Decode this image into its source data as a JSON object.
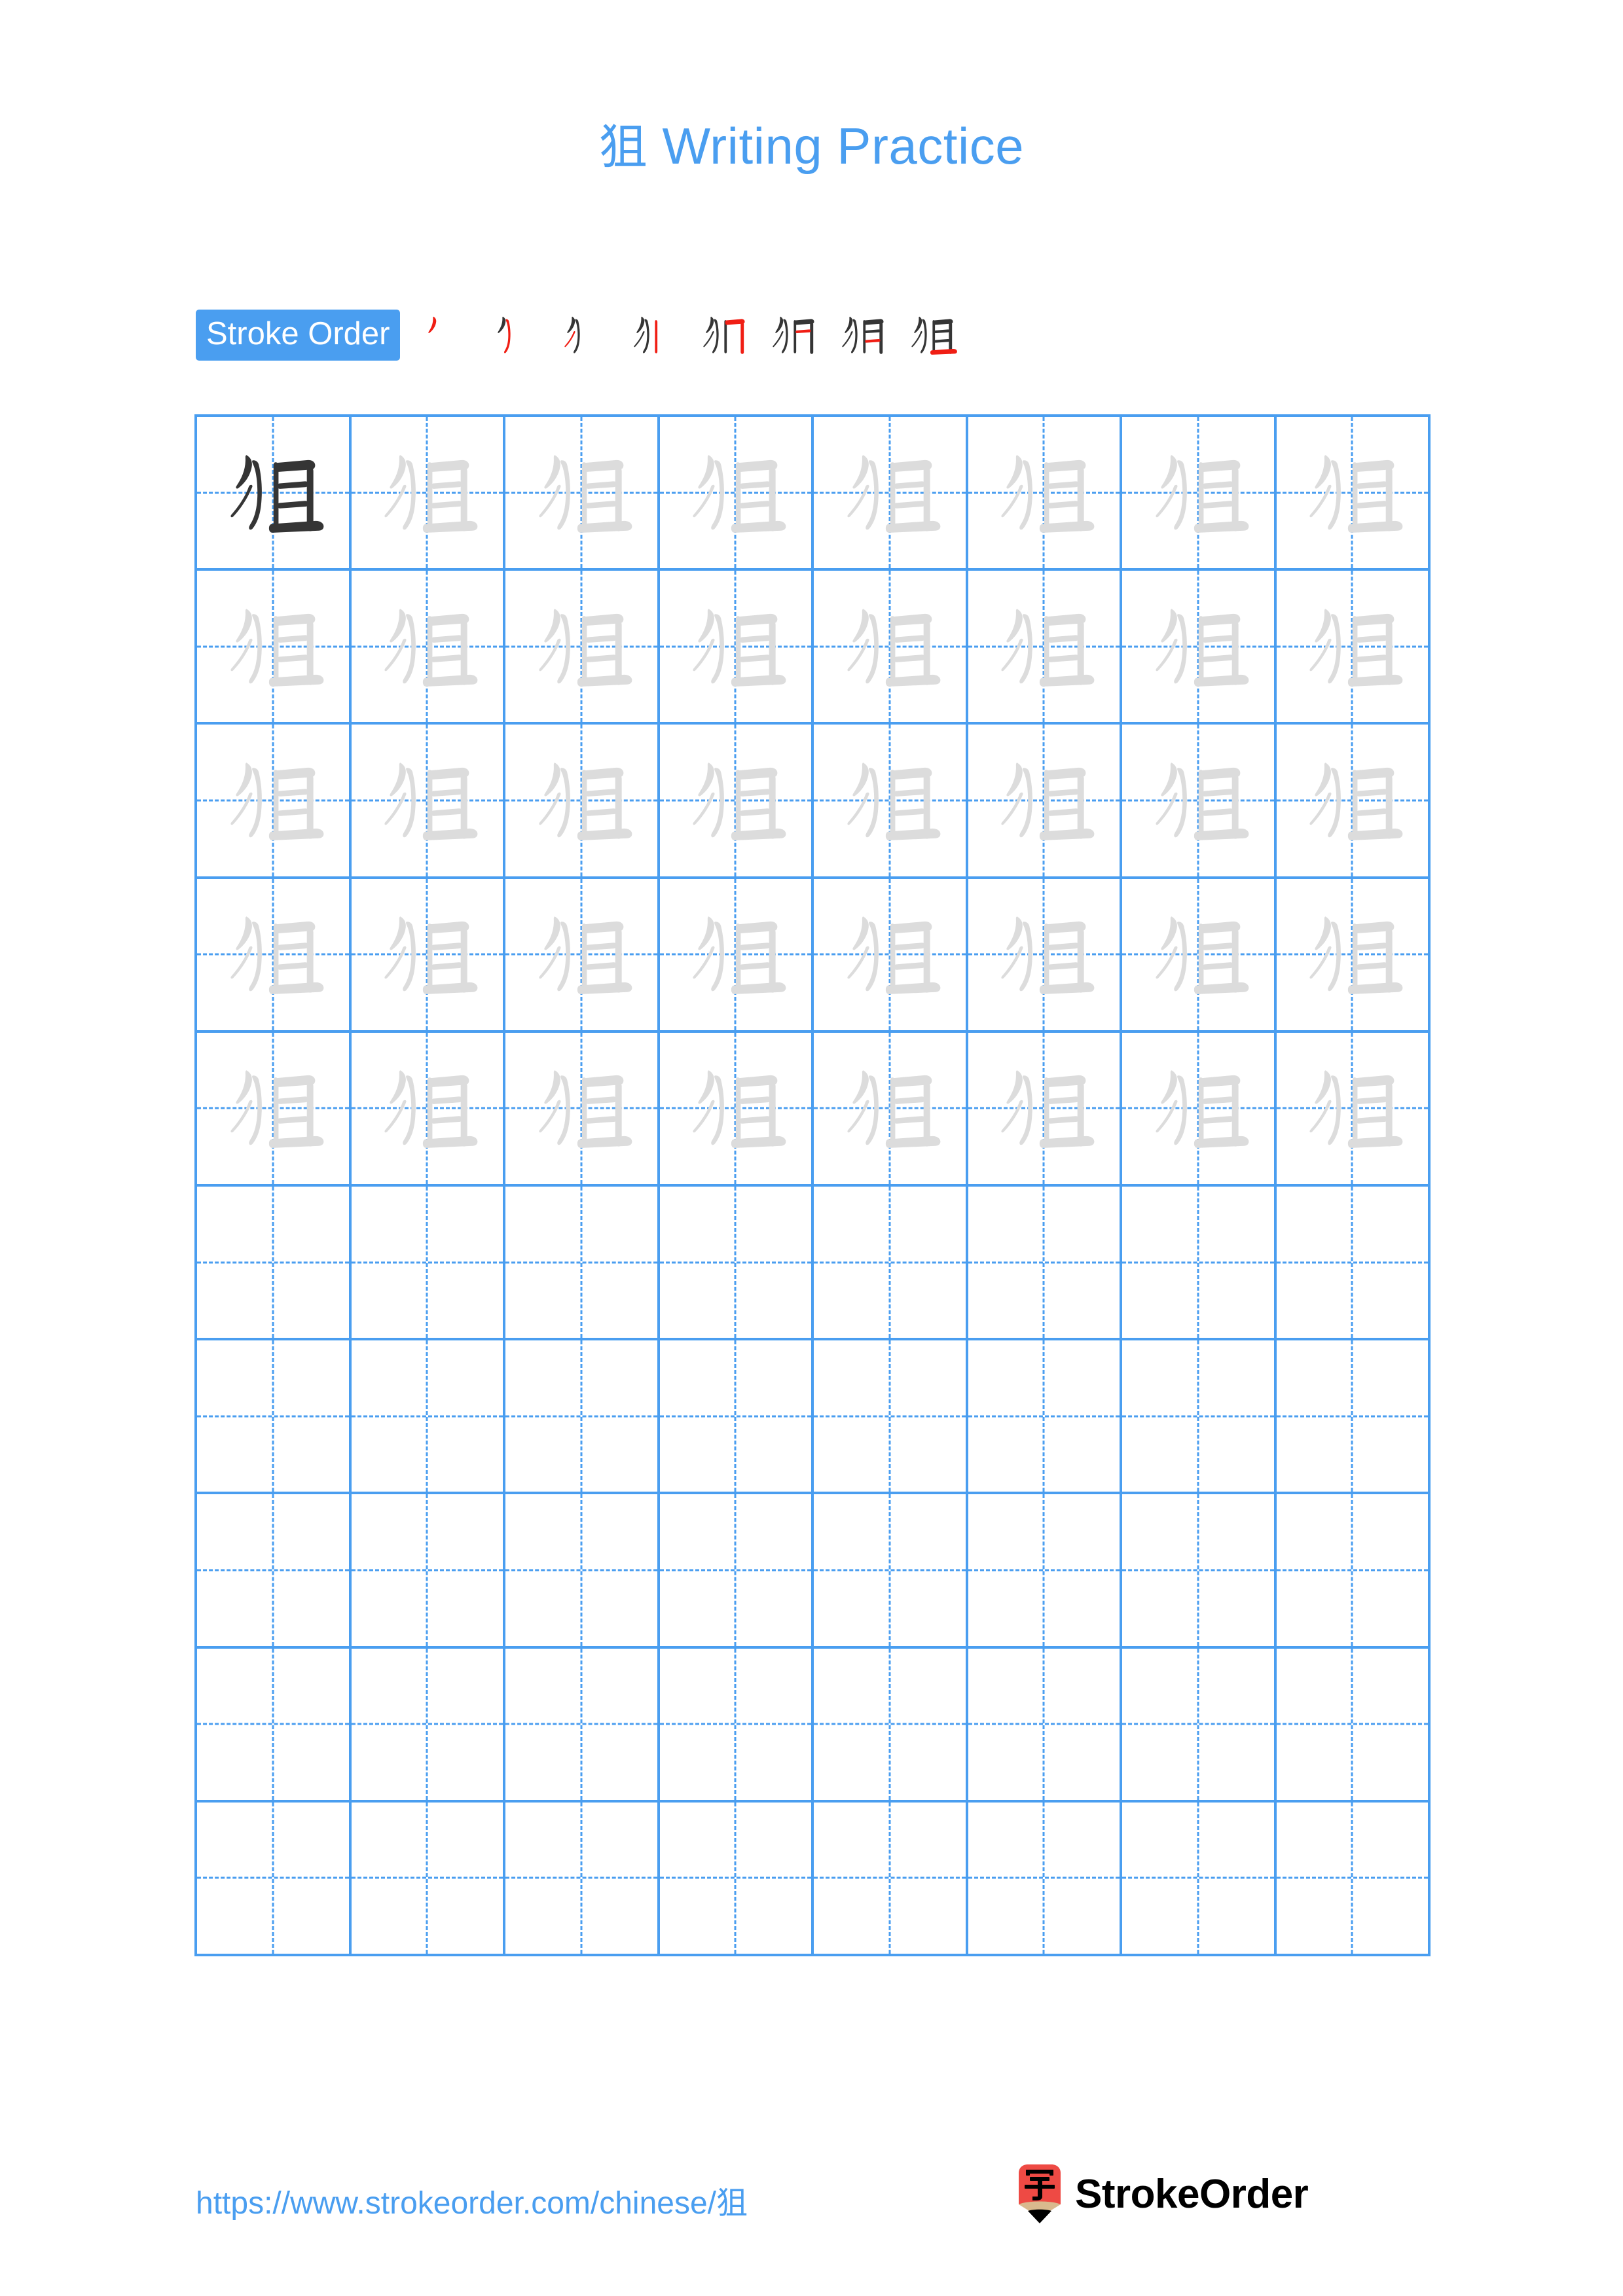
{
  "character": "狙",
  "page": {
    "title": "狙 Writing Practice",
    "title_char": "狙",
    "title_text": " Writing Practice",
    "background_color": "#ffffff"
  },
  "colors": {
    "accent_blue": "#4a9ef0",
    "grid_line": "#4a9ef0",
    "guide_dash": "#4a9ef0",
    "model_char": "#353535",
    "trace_char": "#dcdcdc",
    "new_stroke_red": "#f01e14",
    "existing_stroke": "#353535",
    "logo_red": "#ee4a44",
    "logo_wood": "#d9b98e",
    "logo_tip": "#000000",
    "brand_text": "#000000"
  },
  "stroke_order": {
    "label": "Stroke Order",
    "total_strokes": 8,
    "steps": [
      1,
      2,
      3,
      4,
      5,
      6,
      7,
      8
    ]
  },
  "grid": {
    "columns": 8,
    "rows": 10,
    "total_cells": 80,
    "model_cells": 1,
    "trace_cells": 39,
    "blank_cells": 40,
    "filled_rows": 5,
    "blank_rows": 5,
    "guide_style": "dashed-crosshair",
    "cell_types": [
      [
        "model",
        "trace",
        "trace",
        "trace",
        "trace",
        "trace",
        "trace",
        "trace"
      ],
      [
        "trace",
        "trace",
        "trace",
        "trace",
        "trace",
        "trace",
        "trace",
        "trace"
      ],
      [
        "trace",
        "trace",
        "trace",
        "trace",
        "trace",
        "trace",
        "trace",
        "trace"
      ],
      [
        "trace",
        "trace",
        "trace",
        "trace",
        "trace",
        "trace",
        "trace",
        "trace"
      ],
      [
        "trace",
        "trace",
        "trace",
        "trace",
        "trace",
        "trace",
        "trace",
        "trace"
      ],
      [
        "blank",
        "blank",
        "blank",
        "blank",
        "blank",
        "blank",
        "blank",
        "blank"
      ],
      [
        "blank",
        "blank",
        "blank",
        "blank",
        "blank",
        "blank",
        "blank",
        "blank"
      ],
      [
        "blank",
        "blank",
        "blank",
        "blank",
        "blank",
        "blank",
        "blank",
        "blank"
      ],
      [
        "blank",
        "blank",
        "blank",
        "blank",
        "blank",
        "blank",
        "blank",
        "blank"
      ],
      [
        "blank",
        "blank",
        "blank",
        "blank",
        "blank",
        "blank",
        "blank",
        "blank"
      ]
    ]
  },
  "footer": {
    "url_text": "https://www.strokeorder.com/chinese/狙",
    "url_prefix": "https://www.strokeorder.com/chinese/",
    "url_char": "狙",
    "brand_name": "StrokeOrder",
    "logo_icon": "pencil-zi-icon",
    "logo_glyph": "字"
  }
}
